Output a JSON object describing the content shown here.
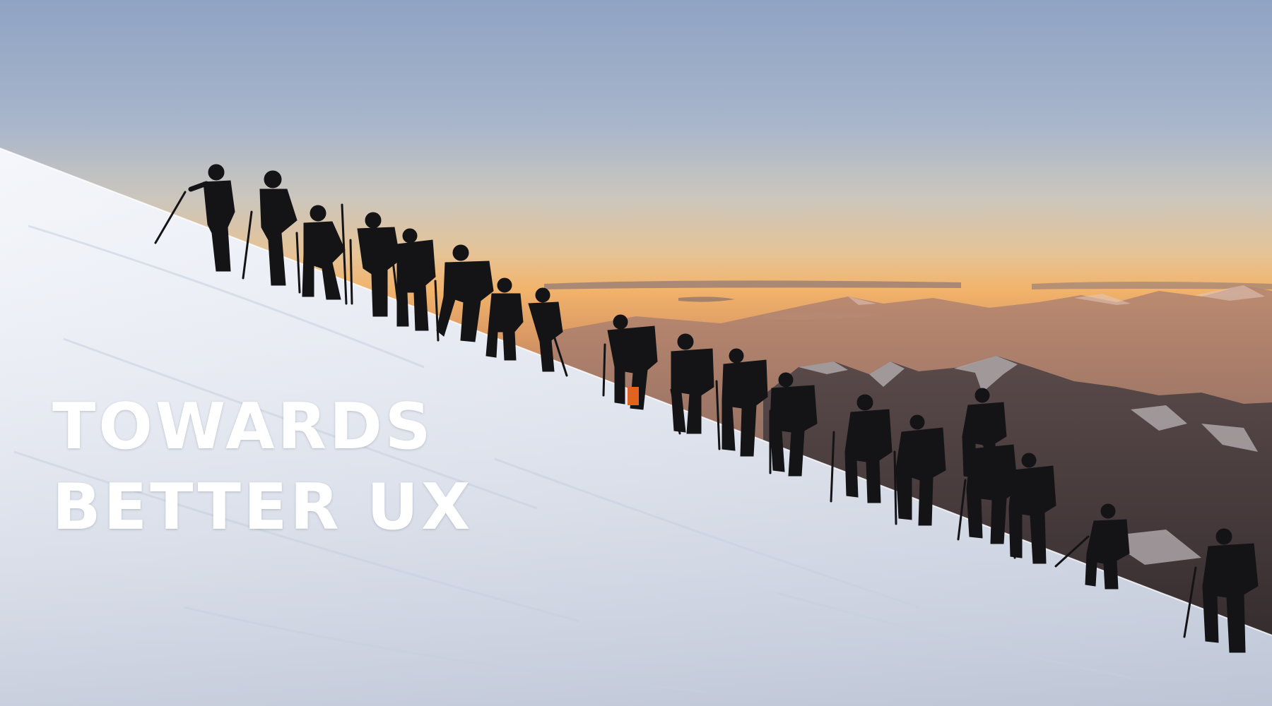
{
  "headline": {
    "line1": "TOWARDS",
    "line2": "BETTER UX"
  },
  "colors": {
    "sky_top": "#8fa3c4",
    "sky_mid": "#dcc7a4",
    "sky_horizon": "#f2b36b",
    "snow_light": "#eef1f7",
    "snow_shadow": "#c9d0de",
    "mountains_far": "#8a6a5c",
    "mountains_near": "#3b3234",
    "silhouette": "#141417",
    "headline_text": "#ffffff"
  }
}
